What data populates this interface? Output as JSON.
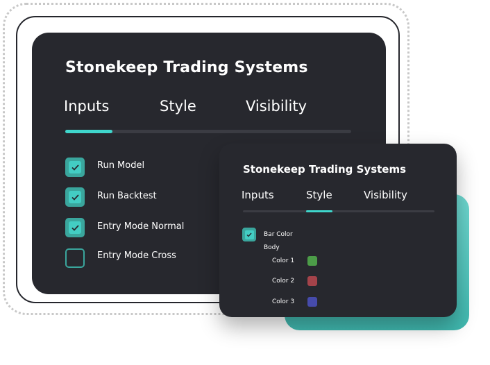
{
  "main_panel": {
    "title": "Stonekeep Trading Systems",
    "tabs": [
      {
        "label": "Inputs",
        "active": true
      },
      {
        "label": "Style",
        "active": false
      },
      {
        "label": "Visibility",
        "active": false
      }
    ],
    "options": [
      {
        "label": "Run Model",
        "checked": true
      },
      {
        "label": "Run Backtest",
        "checked": true
      },
      {
        "label": "Entry Mode Normal",
        "checked": true
      },
      {
        "label": "Entry Mode Cross",
        "checked": false
      }
    ]
  },
  "front_panel": {
    "title": "Stonekeep Trading Systems",
    "tabs": [
      {
        "label": "Inputs",
        "active": false
      },
      {
        "label": "Style",
        "active": true
      },
      {
        "label": "Visibility",
        "active": false
      }
    ],
    "bar_color": {
      "label": "Bar Color",
      "checked": true
    },
    "body_label": "Body",
    "colors": [
      {
        "label": "Color 1",
        "hex": "#4c9c48"
      },
      {
        "label": "Color 2",
        "hex": "#a4434a"
      },
      {
        "label": "Color 3",
        "hex": "#464bab"
      }
    ]
  },
  "theme": {
    "accent": "#3fd6cc",
    "panel_bg": "#27282e"
  }
}
